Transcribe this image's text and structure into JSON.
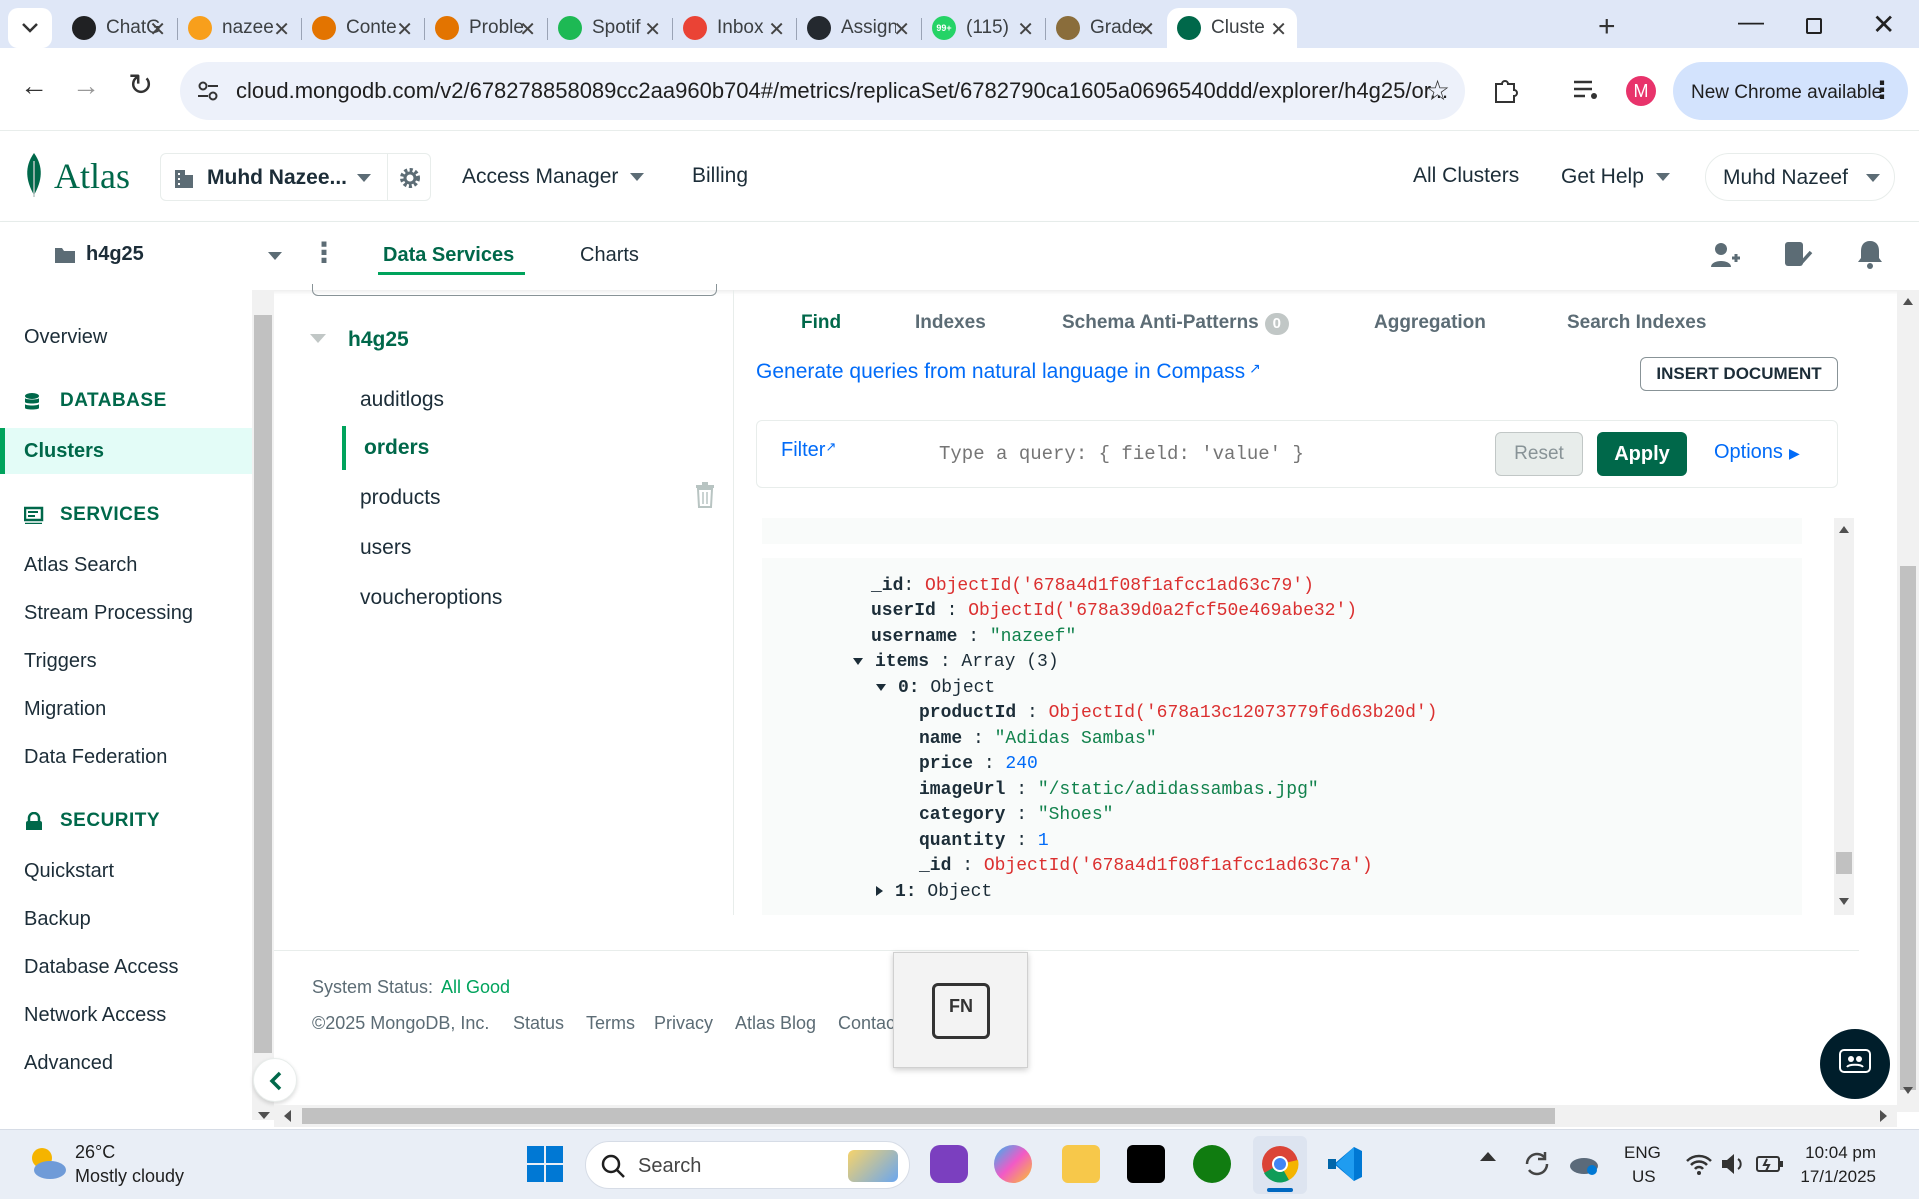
{
  "browser": {
    "tabs": [
      {
        "label": "ChatG",
        "icon": "chatgpt-icon",
        "color": "#202123"
      },
      {
        "label": "nazee",
        "icon": "leetcode-icon",
        "color": "#f89f1b"
      },
      {
        "label": "Conte",
        "icon": "chart-bars-icon",
        "color": "#e37400"
      },
      {
        "label": "Proble",
        "icon": "chart-bars-icon",
        "color": "#e37400"
      },
      {
        "label": "Spotif",
        "icon": "spotify-icon",
        "color": "#1db954"
      },
      {
        "label": "Inbox",
        "icon": "gmail-icon",
        "color": "#ea4335"
      },
      {
        "label": "Assign",
        "icon": "github-icon",
        "color": "#24292f"
      },
      {
        "label": "(115)",
        "icon": "whatsapp-icon",
        "color": "#25d366",
        "badge": "99+"
      },
      {
        "label": "Grade",
        "icon": "university-icon",
        "color": "#8a6d3b"
      },
      {
        "label": "Cluste",
        "icon": "mongodb-leaf-icon",
        "color": "#00684a"
      }
    ],
    "url": "cloud.mongodb.com/v2/678278858089cc2aa960b704#/metrics/replicaSet/6782790ca1605a0696540ddd/explorer/h4g25/or...",
    "new_chrome": "New Chrome available",
    "profile_initial": "M"
  },
  "header": {
    "logo": "Atlas",
    "org": "Muhd Nazee...",
    "access_manager": "Access Manager",
    "billing": "Billing",
    "all_clusters": "All Clusters",
    "get_help": "Get Help",
    "user": "Muhd Nazeef"
  },
  "project_bar": {
    "project": "h4g25",
    "tabs": [
      "Data Services",
      "Charts"
    ]
  },
  "sidebar": {
    "overview": "Overview",
    "database_header": "DATABASE",
    "clusters": "Clusters",
    "services_header": "SERVICES",
    "services": [
      "Atlas Search",
      "Stream Processing",
      "Triggers",
      "Migration",
      "Data Federation"
    ],
    "security_header": "SECURITY",
    "security": [
      "Quickstart",
      "Backup",
      "Database Access",
      "Network Access",
      "Advanced"
    ]
  },
  "tree": {
    "database": "h4g25",
    "collections": [
      "auditlogs",
      "orders",
      "products",
      "users",
      "voucheroptions"
    ]
  },
  "main": {
    "tabs": [
      "Find",
      "Indexes",
      "Schema Anti-Patterns",
      "Aggregation",
      "Search Indexes"
    ],
    "anti_pattern_count": "0",
    "compass_link": "Generate queries from natural language in Compass",
    "insert_button": "INSERT DOCUMENT",
    "filter_label": "Filter",
    "filter_placeholder": "Type a query: { field: 'value' }",
    "reset": "Reset",
    "apply": "Apply",
    "options": "Options"
  },
  "document": {
    "id_key": "_id",
    "id_val": "ObjectId('678a4d1f08f1afcc1ad63c79')",
    "userId_key": "userId",
    "userId_val": "ObjectId('678a39d0a2fcf50e469abe32')",
    "username_key": "username",
    "username_val": "\"nazeef\"",
    "items_key": "items",
    "items_val": "Array (3)",
    "item0_key": "0:",
    "item0_val": "Object",
    "productId_key": "productId",
    "productId_val": "ObjectId('678a13c12073779f6d63b20d')",
    "name_key": "name",
    "name_val": "\"Adidas Sambas\"",
    "price_key": "price",
    "price_val": "240",
    "imageUrl_key": "imageUrl",
    "imageUrl_val": "\"/static/adidassambas.jpg\"",
    "category_key": "category",
    "category_val": "\"Shoes\"",
    "quantity_key": "quantity",
    "quantity_val": "1",
    "item_id_key": "_id",
    "item_id_val": "ObjectId('678a4d1f08f1afcc1ad63c7a')",
    "item1_key": "1:",
    "item1_val": "Object"
  },
  "footer": {
    "status_label": "System Status:",
    "status_value": "All Good",
    "copyright": "©2025 MongoDB, Inc.",
    "links": [
      "Status",
      "Terms",
      "Privacy",
      "Atlas Blog",
      "Contact Sa"
    ]
  },
  "fn_overlay": "FN",
  "taskbar": {
    "temperature": "26°C",
    "weather": "Mostly cloudy",
    "search": "Search",
    "lang": "ENG",
    "region": "US",
    "time": "10:04 pm",
    "date": "17/1/2025"
  }
}
